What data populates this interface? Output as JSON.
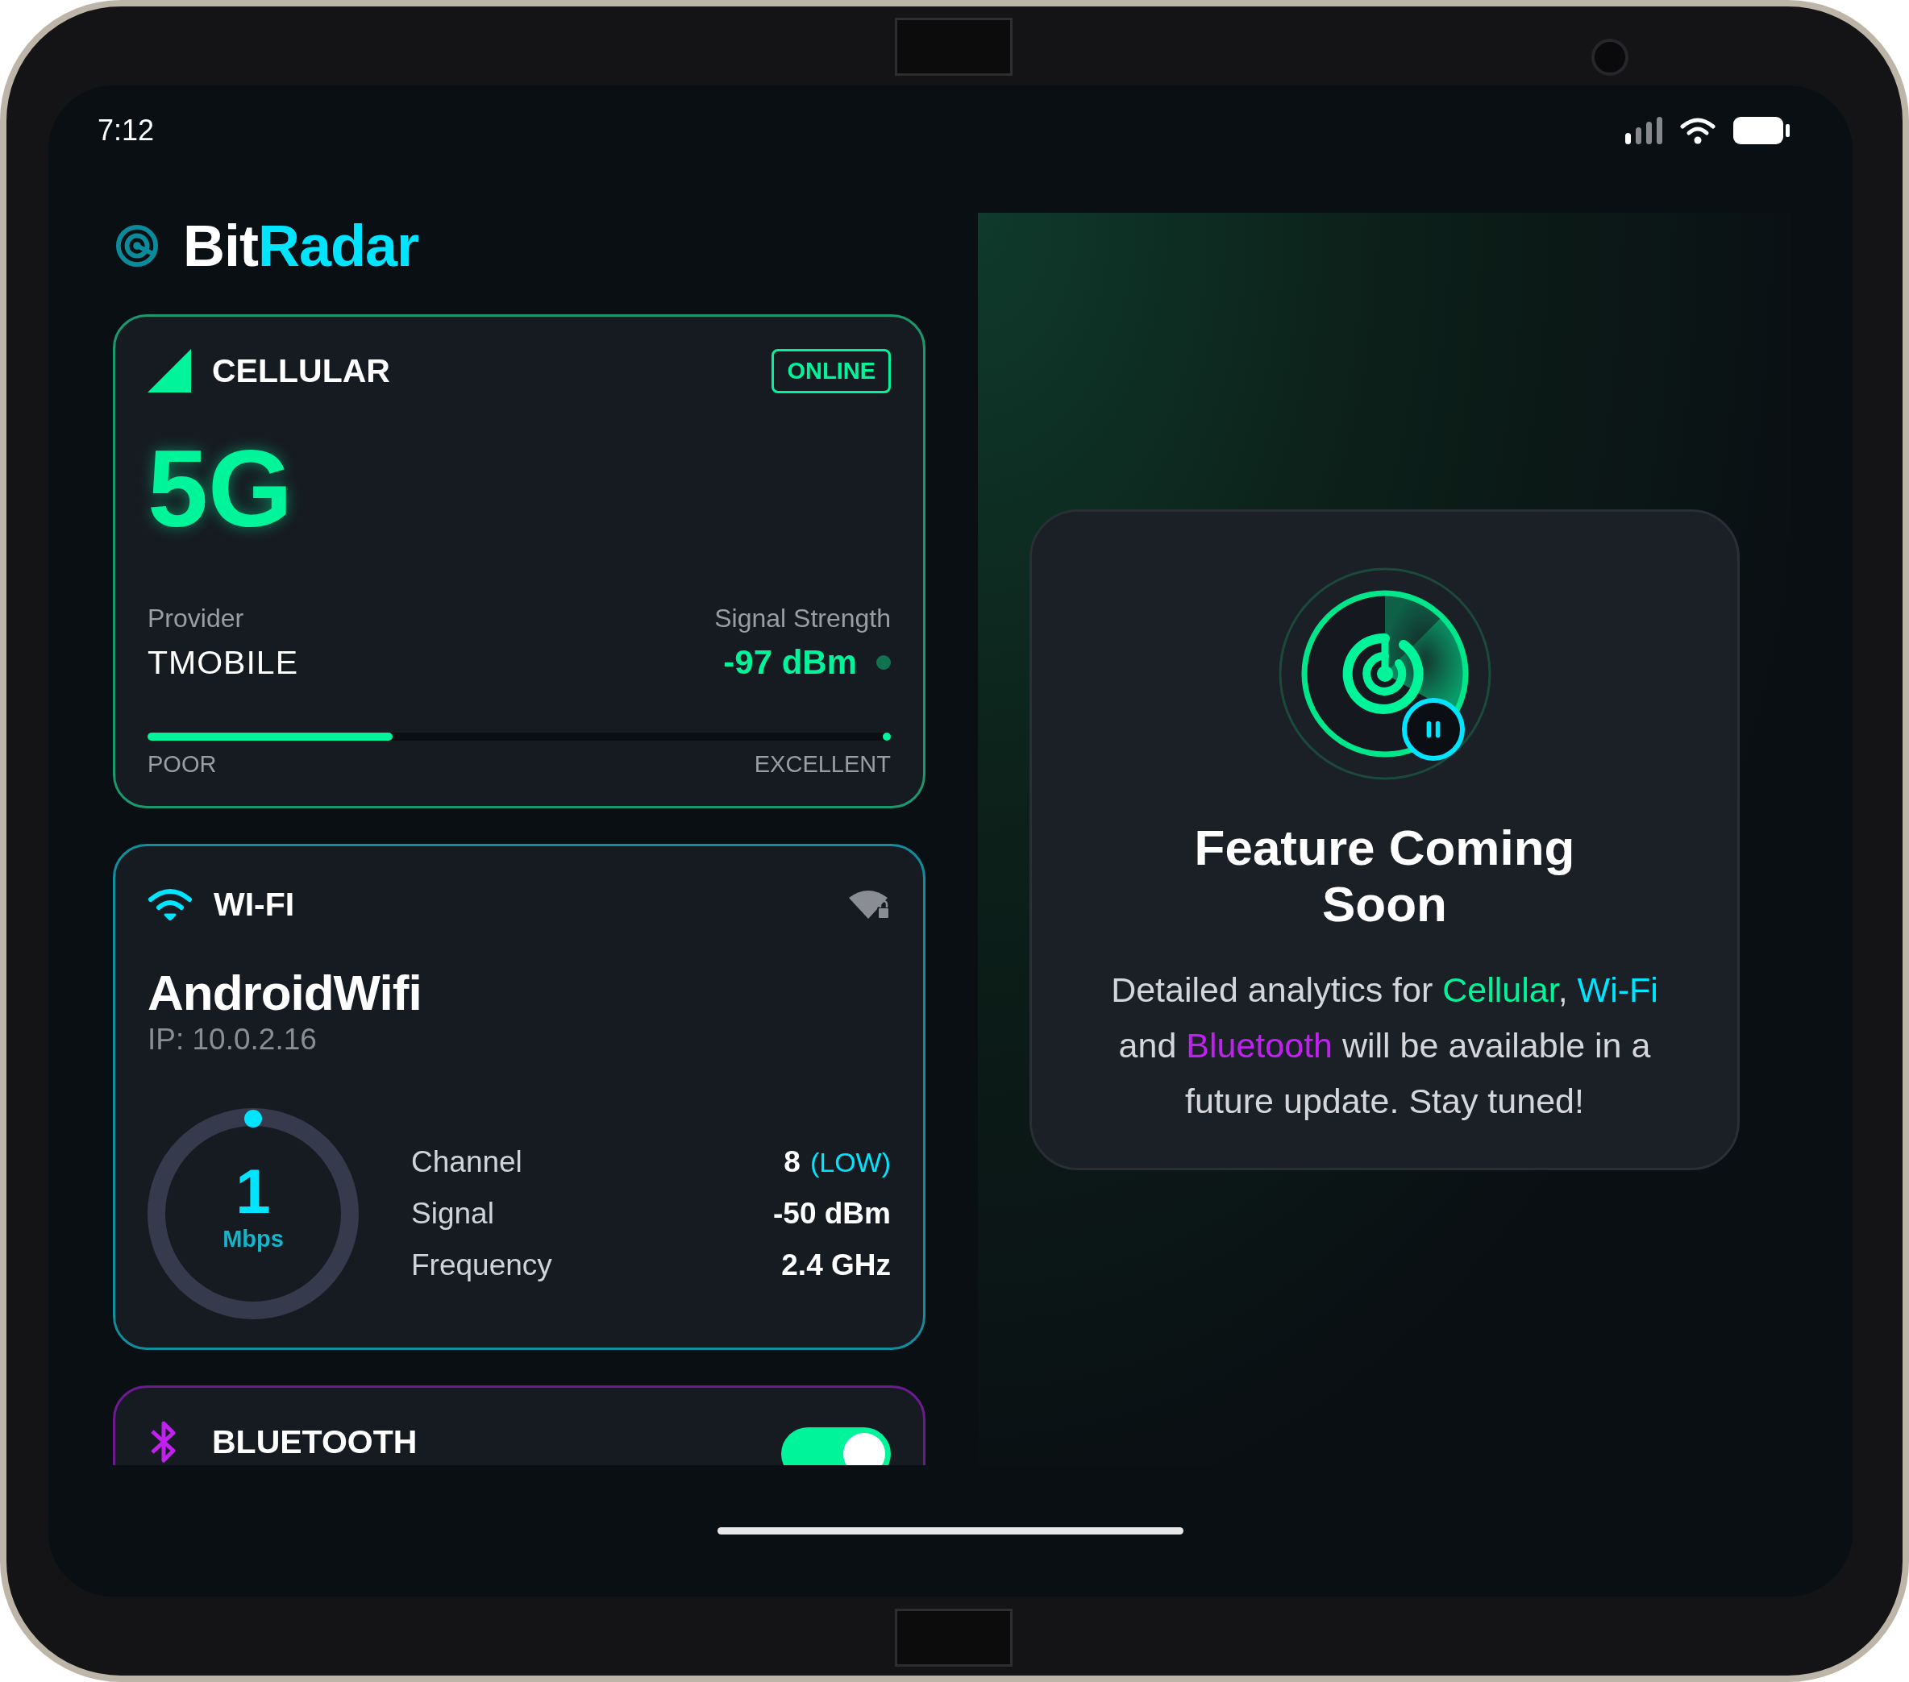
{
  "status_bar": {
    "time": "7:12"
  },
  "app_title": [
    {
      "text": "Bit",
      "color": "#ffffff"
    },
    {
      "text": "Radar",
      "color": "#00e5ff"
    }
  ],
  "cellular": {
    "title": "CELLULAR",
    "status": "ONLINE",
    "technology": "5G",
    "provider_label": "Provider",
    "provider": "TMOBILE",
    "signal_label": "Signal Strength",
    "signal": "-97 dBm",
    "level": 0.33,
    "scale_min": "POOR",
    "scale_max": "EXCELLENT"
  },
  "wifi": {
    "title": "WI-FI",
    "ssid": "AndroidWifi",
    "ip": "IP: 10.0.2.16",
    "speed": "1",
    "speed_unit": "Mbps",
    "details": [
      {
        "label": "Channel",
        "value": "8",
        "note": "(LOW)"
      },
      {
        "label": "Signal",
        "value": "-50 dBm"
      },
      {
        "label": "Frequency",
        "value": "2.4 GHz"
      }
    ]
  },
  "bluetooth": {
    "title": "BLUETOOTH",
    "on": true
  },
  "feature": {
    "title": "Feature Coming Soon",
    "description": [
      {
        "text": "Detailed analytics for ",
        "color": "#d4d6da"
      },
      {
        "text": "Cellular",
        "color": "#00f59a"
      },
      {
        "text": ", ",
        "color": "#d4d6da"
      },
      {
        "text": "Wi-Fi",
        "color": "#00e5ff"
      },
      {
        "text": " and ",
        "color": "#d4d6da"
      },
      {
        "text": "Bluetooth",
        "color": "#c020f0"
      },
      {
        "text": " will be available in a future update. Stay tuned!",
        "color": "#d4d6da"
      }
    ]
  }
}
